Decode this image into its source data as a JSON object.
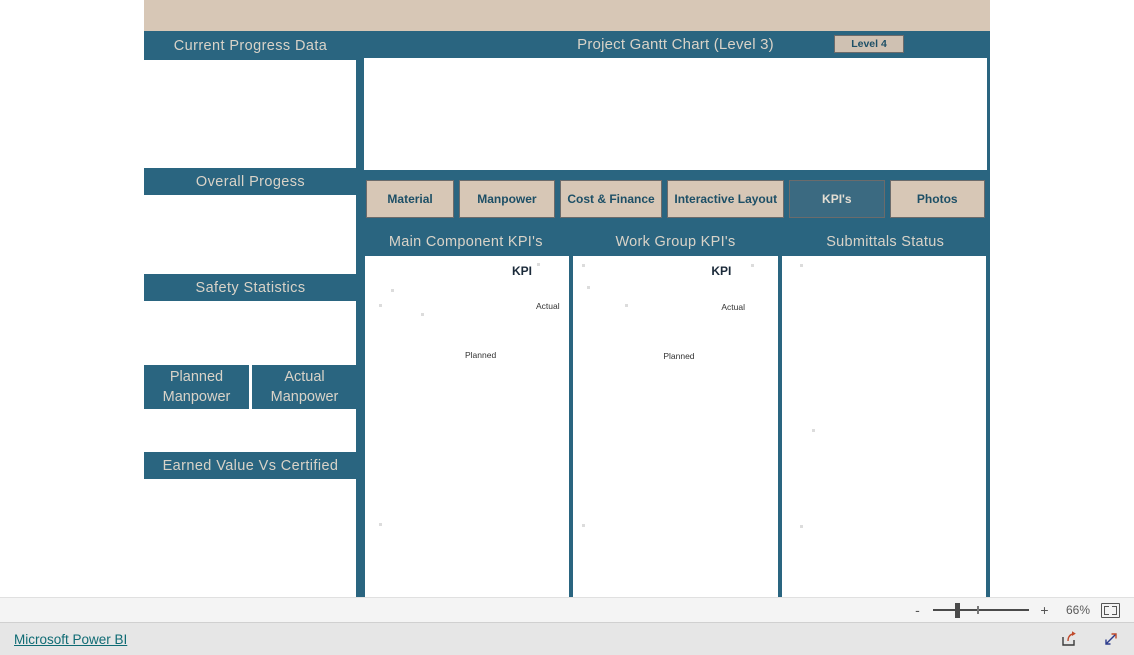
{
  "report": {
    "left_panels": [
      {
        "id": "current-progress-data",
        "title": "Current Progress Data"
      },
      {
        "id": "overall-progess",
        "title": "Overall Progess"
      },
      {
        "id": "safety-statistics",
        "title": "Safety Statistics"
      },
      {
        "id": "earned-value-vs-certified",
        "title": "Earned Value Vs Certified"
      }
    ],
    "manpower_buttons": [
      {
        "id": "planned-manpower",
        "line1": "Planned",
        "line2": "Manpower"
      },
      {
        "id": "actual-manpower",
        "line1": "Actual",
        "line2": "Manpower"
      }
    ],
    "gantt": {
      "title": "Project Gantt Chart (Level 3)",
      "level_button": "Level 4"
    },
    "tabs": [
      {
        "label": "Material",
        "selected": false
      },
      {
        "label": "Manpower",
        "selected": false
      },
      {
        "label": "Cost & Finance",
        "selected": false
      },
      {
        "label": "Interactive Layout",
        "selected": false
      },
      {
        "label": "KPI's",
        "selected": true
      },
      {
        "label": "Photos",
        "selected": false
      }
    ],
    "kpi_headers": [
      "Main Component KPI's",
      "Work Group KPI's",
      "Submittals Status"
    ],
    "kpi_gauges": [
      {
        "title": "KPI",
        "actual_label": "Actual",
        "planned_label": "Planned"
      },
      {
        "title": "KPI",
        "actual_label": "Actual",
        "planned_label": "Planned"
      }
    ],
    "colors": {
      "teal": "#2a6580",
      "tan": "#d7c7b6",
      "header_text": "#d9d3c8",
      "tab_text": "#1d4f66",
      "link": "#0f6b74"
    }
  },
  "statusbar": {
    "zoom_out": "-",
    "zoom_in": "+",
    "zoom_level": "66%",
    "fit_icon": "fit-to-page-icon"
  },
  "footer": {
    "brand": "Microsoft Power BI",
    "share_icon": "share-icon",
    "fullscreen_icon": "fullscreen-icon"
  }
}
